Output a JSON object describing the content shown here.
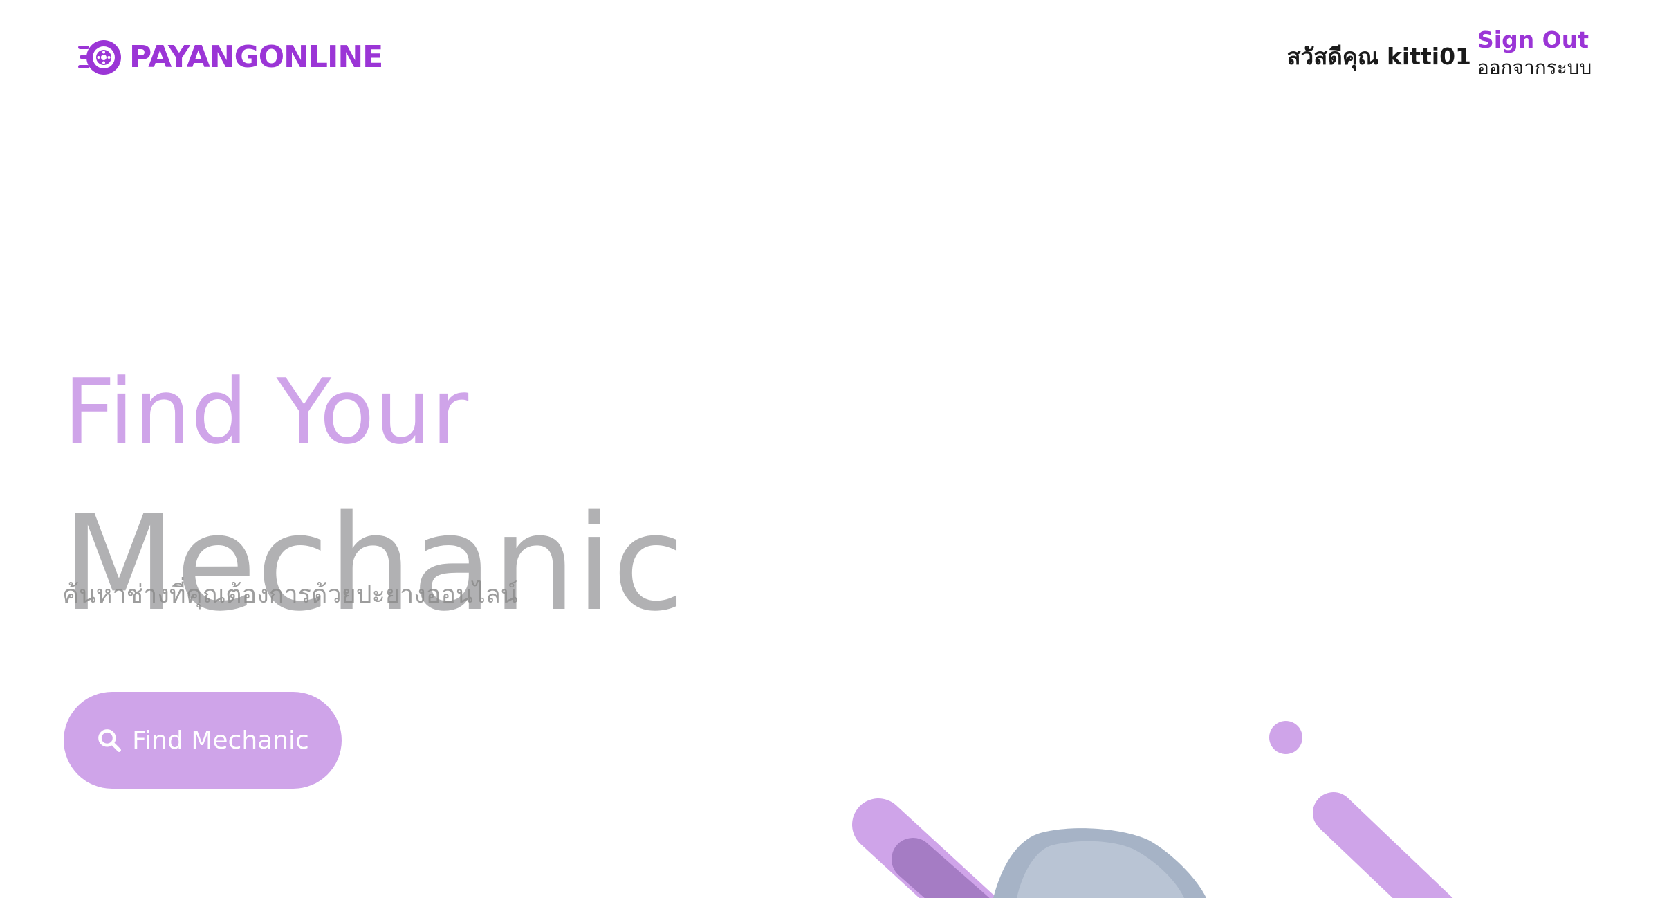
{
  "header": {
    "brand": "PAYANGONLINE",
    "logo_icon": "tire-wheel-icon",
    "greeting_prefix": "สวัสดีคุณ",
    "username": "kitti01",
    "signout_label": "Sign Out",
    "signout_sub": "ออกจากระบบ"
  },
  "hero": {
    "line1": "Find Your",
    "line2": "Mechanic",
    "subtitle": "ค้นหาช่างที่คุณต้องการด้วยปะยางออนไลน์",
    "button_label": "Find Mechanic",
    "button_icon": "search-icon"
  },
  "colors": {
    "brand_purple": "#9b35d6",
    "accent_light": "#cfa4e9",
    "accent_dark": "#a57cc4",
    "title_gray": "#b1b1b3",
    "text_dark": "#1a1a1a"
  },
  "illustration": {
    "subject": "mechanic-with-cap-illustration"
  }
}
